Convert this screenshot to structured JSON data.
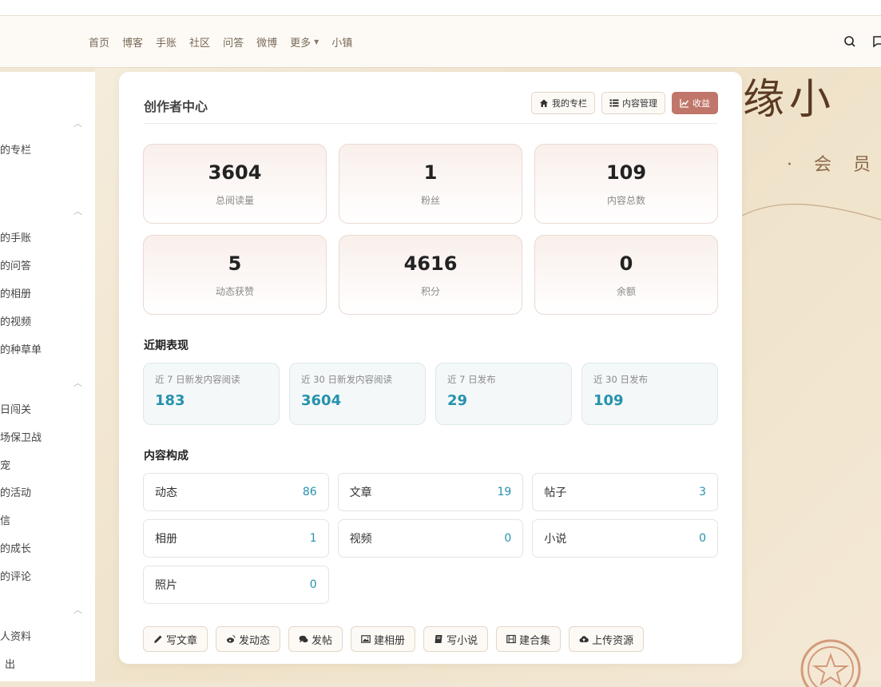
{
  "nav": {
    "links": [
      "首页",
      "博客",
      "手账",
      "社区",
      "问答",
      "微博",
      "更多",
      "小镇"
    ]
  },
  "background": {
    "title": "缘小",
    "subtitle": "· 会 员"
  },
  "sidebar": {
    "items": [
      "的专栏",
      "的手账",
      "的问答",
      "的相册",
      "的视频",
      "的种草单",
      "日闯关",
      "场保卫战",
      "宠",
      "的活动",
      "信",
      "的成长",
      "的评论",
      "人资料",
      "出"
    ]
  },
  "card": {
    "title": "创作者中心",
    "buttons": {
      "my_column": "我的专栏",
      "content_manage": "内容管理",
      "income": "收益"
    },
    "stats": [
      {
        "value": "3604",
        "label": "总阅读量"
      },
      {
        "value": "1",
        "label": "粉丝"
      },
      {
        "value": "109",
        "label": "内容总数"
      },
      {
        "value": "5",
        "label": "动态获赞"
      },
      {
        "value": "4616",
        "label": "积分"
      },
      {
        "value": "0",
        "label": "余额"
      }
    ],
    "recent_title": "近期表现",
    "recent": [
      {
        "label": "近 7 日新发内容阅读",
        "value": "183"
      },
      {
        "label": "近 30 日新发内容阅读",
        "value": "3604"
      },
      {
        "label": "近 7 日发布",
        "value": "29"
      },
      {
        "label": "近 30 日发布",
        "value": "109"
      }
    ],
    "composition_title": "内容构成",
    "composition": [
      {
        "label": "动态",
        "value": "86"
      },
      {
        "label": "文章",
        "value": "19"
      },
      {
        "label": "帖子",
        "value": "3"
      },
      {
        "label": "相册",
        "value": "1"
      },
      {
        "label": "视频",
        "value": "0"
      },
      {
        "label": "小说",
        "value": "0"
      },
      {
        "label": "照片",
        "value": "0"
      }
    ],
    "actions": {
      "write_article": "写文章",
      "post_status": "发动态",
      "post_thread": "发帖",
      "create_album": "建相册",
      "write_novel": "写小说",
      "create_collection": "建合集",
      "upload_resource": "上传资源"
    }
  },
  "colors": {
    "accent": "#c0766a",
    "metric_blue": "#2592ad",
    "nav_text": "#7a6a55"
  }
}
